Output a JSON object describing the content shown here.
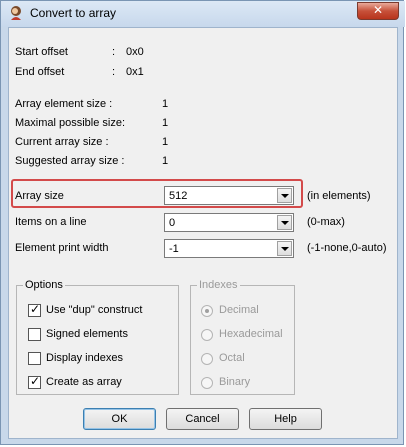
{
  "window": {
    "title": "Convert to array",
    "close_glyph": "✕"
  },
  "info": {
    "start_offset_label": "Start offset",
    "start_offset_colon": ":",
    "start_offset_value": "0x0",
    "end_offset_label": "End offset",
    "end_offset_colon": ":",
    "end_offset_value": "0x1",
    "element_size_label": "Array element size :",
    "element_size_value": "1",
    "max_size_label": "Maximal possible size:",
    "max_size_value": "1",
    "current_size_label": "Current array size :",
    "current_size_value": "1",
    "suggested_size_label": "Suggested array size :",
    "suggested_size_value": "1"
  },
  "fields": {
    "array_size_label": "Array size",
    "array_size_value": "512",
    "array_size_hint": "(in elements)",
    "items_per_line_label": "Items on a line",
    "items_per_line_value": "0",
    "items_per_line_hint": "(0-max)",
    "print_width_label": "Element print width",
    "print_width_value": "-1",
    "print_width_hint": "(-1-none,0-auto)"
  },
  "options": {
    "title": "Options",
    "items": [
      {
        "label": "Use \"dup\" construct",
        "checked": true,
        "mark": "✓"
      },
      {
        "label": "Signed elements",
        "checked": false
      },
      {
        "label": "Display indexes",
        "checked": false
      },
      {
        "label": "Create as array",
        "checked": true,
        "mark": "✓"
      }
    ]
  },
  "indexes": {
    "title": "Indexes",
    "items": [
      {
        "label": "Decimal",
        "selected": true
      },
      {
        "label": "Hexadecimal",
        "selected": false
      },
      {
        "label": "Octal",
        "selected": false
      },
      {
        "label": "Binary",
        "selected": false
      }
    ]
  },
  "buttons": {
    "ok": "OK",
    "cancel": "Cancel",
    "help": "Help"
  },
  "colors": {
    "highlight": "#d34a4a",
    "title_bar": "#c7d8ec",
    "close_button": "#c7513a"
  }
}
